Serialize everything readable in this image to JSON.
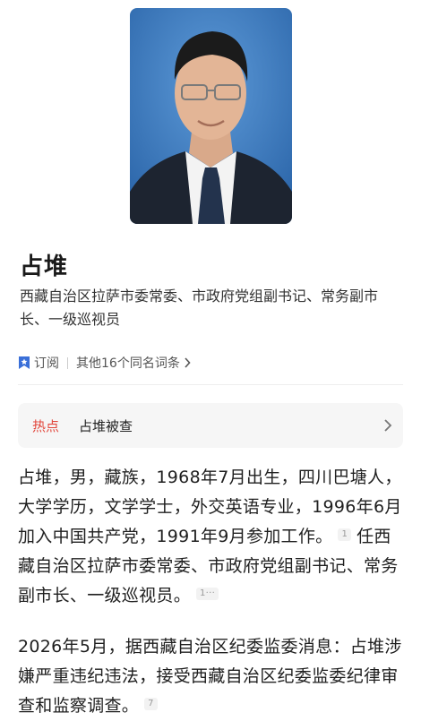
{
  "person": {
    "name": "占堆",
    "subtitle": "西藏自治区拉萨市委常委、市政府党组副书记、常务副市长、一级巡视员"
  },
  "actions": {
    "subscribe_label": "订阅",
    "namesakes_label": "其他16个同名词条"
  },
  "hot_topic": {
    "tag": "热点",
    "title": "占堆被查"
  },
  "paragraphs": {
    "p1": {
      "text_a": "占堆，男，藏族，1968年7月出生，四川巴塘人，大学学历，文学学士，外交英语专业，1996年6月加入中国共产党，1991年9月参加工作。",
      "cite_a": "1",
      "text_b": "任西藏自治区拉萨市委常委、市政府党组副书记、常务副市长、一级巡视员。",
      "cite_b": "1···"
    },
    "p2": {
      "text_a": "2026年5月，据西藏自治区纪委监委消息：占堆涉嫌严重违纪违法，接受西藏自治区纪委监委纪律审查和监察调查。",
      "cite_a": "7"
    }
  },
  "colors": {
    "accent_blue": "#3a6fd8",
    "hot_red": "#e2483d",
    "portrait_bg": "#2f6fb5"
  },
  "icons": {
    "subscribe": "bookmark-star-icon",
    "namesakes_chevron": "chevron-right-icon",
    "hot_chevron": "chevron-right-icon"
  }
}
